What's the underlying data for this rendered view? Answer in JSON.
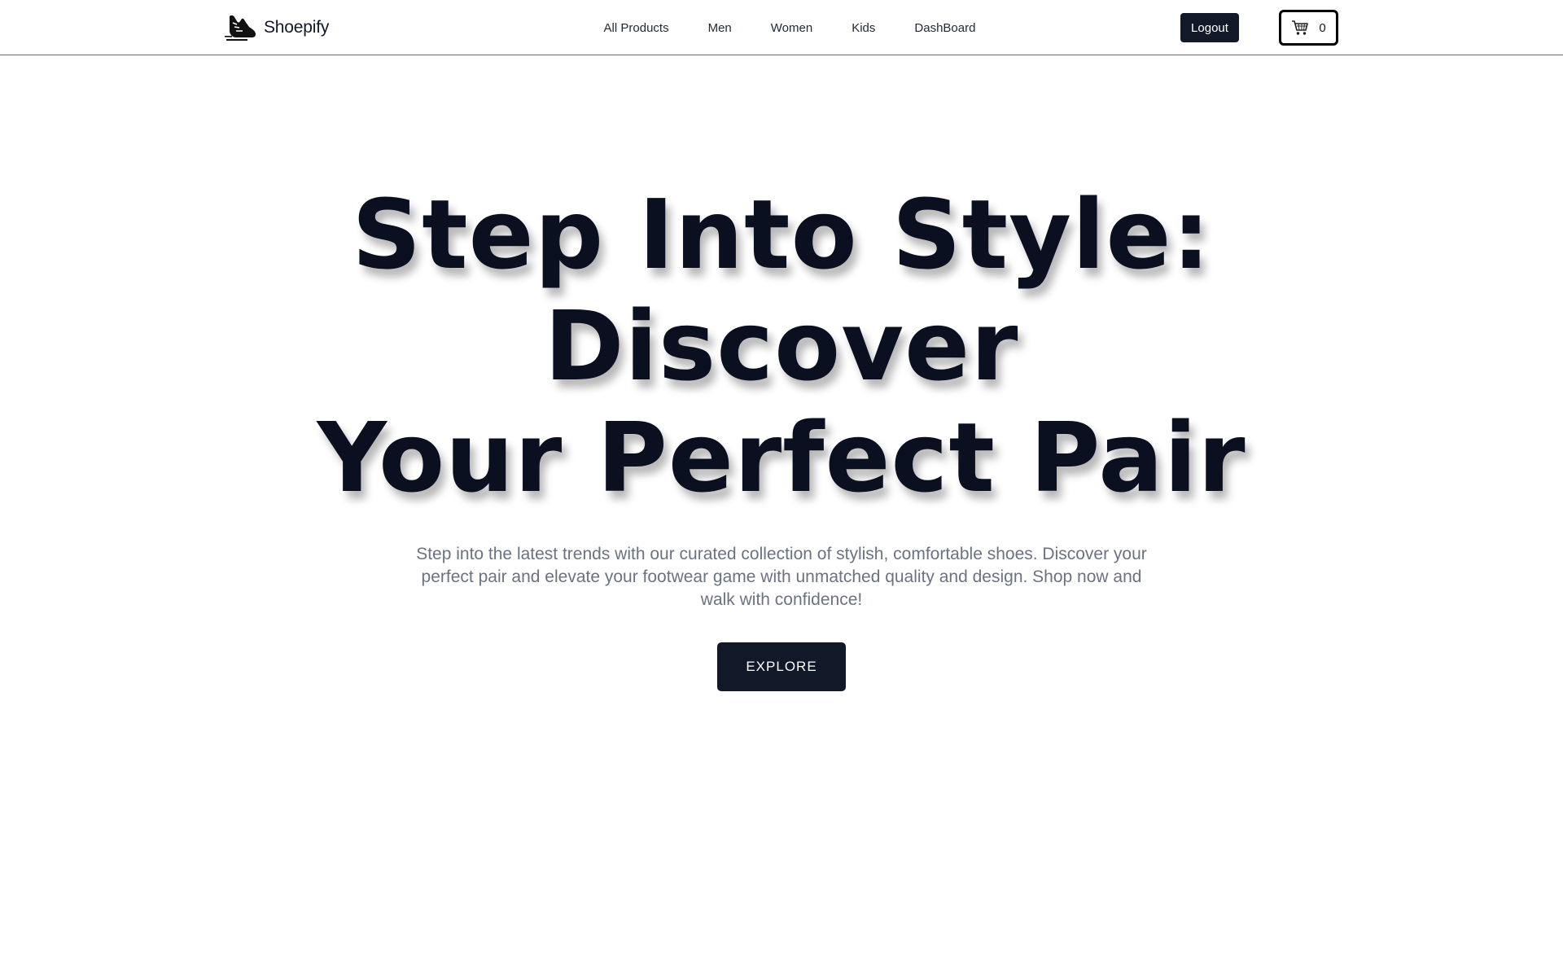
{
  "navbar": {
    "brand_name": "Shoepify",
    "brand_icon": "sneaker-icon",
    "links": [
      "All Products",
      "Men",
      "Women",
      "Kids",
      "DashBoard"
    ],
    "logout_label": "Logout",
    "cart": {
      "icon": "cart-icon",
      "count": "0"
    }
  },
  "hero": {
    "title_lines": [
      "Step Into Style:",
      "Discover",
      "Your Perfect Pair"
    ],
    "subtitle": "Step into the latest trends with our curated collection of stylish, comfortable shoes. Discover your perfect pair and elevate your footwear game with unmatched quality and design. Shop now and walk with confidence!",
    "cta_label": "EXPLORE"
  },
  "colors": {
    "primary_dark": "#111827",
    "title": "#0b1020",
    "subtitle": "#6b7280",
    "background": "#ffffff"
  }
}
